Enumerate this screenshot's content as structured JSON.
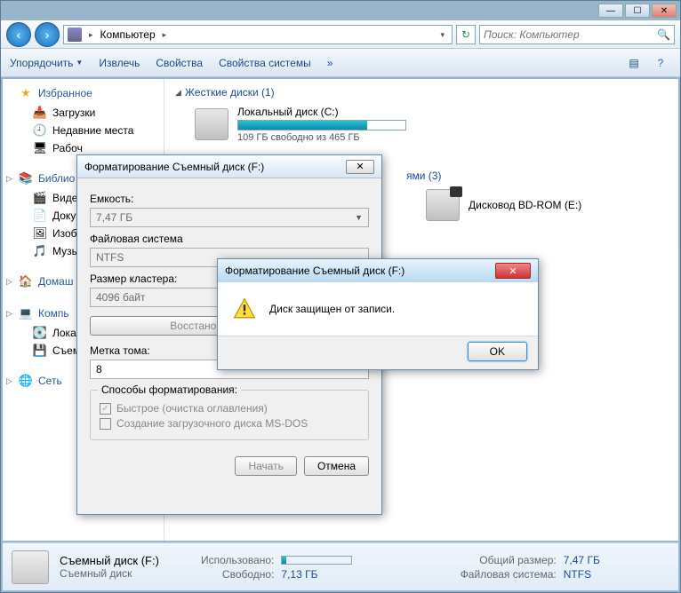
{
  "titlebar": {
    "min": "—",
    "max": "☐",
    "close": "✕"
  },
  "nav": {
    "back": "‹",
    "forward": "›",
    "breadcrumb": "Компьютер",
    "chevron": "▸",
    "refresh": "↻",
    "search_placeholder": "Поиск: Компьютер",
    "search_icon": "🔍"
  },
  "toolbar": {
    "organize": "Упорядочить",
    "extract": "Извлечь",
    "properties": "Свойства",
    "system_props": "Свойства системы",
    "more": "»",
    "view": "▤",
    "help": "?"
  },
  "sidebar": {
    "favorites": {
      "label": "Избранное",
      "star": "★",
      "items": [
        "Загрузки",
        "Недавние места",
        "Рабоч"
      ]
    },
    "libraries": {
      "label": "Библио",
      "items": [
        "Видео",
        "Докум",
        "Изобр",
        "Музы"
      ]
    },
    "homegroup": {
      "label": "Домаш"
    },
    "computer": {
      "label": "Компь",
      "items": [
        "Локал",
        "Съемн"
      ]
    },
    "network": {
      "label": "Сеть"
    }
  },
  "content": {
    "hdd_section": "Жесткие диски (1)",
    "drive_c": {
      "name": "Локальный диск (C:)",
      "free": "109 ГБ свободно из 465 ГБ",
      "fill_pct": 77
    },
    "removable_suffix": "ями (3)",
    "bd_drive": "Дисковод BD-ROM (E:)"
  },
  "details": {
    "title": "Съемный диск (F:)",
    "sub": "Съемный диск",
    "used_k": "Использовано:",
    "total_k": "Общий размер:",
    "total_v": "7,47 ГБ",
    "free_k": "Свободно:",
    "free_v": "7,13 ГБ",
    "fs_k": "Файловая система:",
    "fs_v": "NTFS"
  },
  "format_dialog": {
    "title": "Форматирование Съемный диск (F:)",
    "capacity_label": "Емкость:",
    "capacity_value": "7,47 ГБ",
    "fs_label": "Файловая система",
    "fs_value": "NTFS",
    "cluster_label": "Размер кластера:",
    "cluster_value": "4096 байт",
    "restore_btn": "Восстановить параметр",
    "volume_label": "Метка тома:",
    "volume_value": "8",
    "methods_label": "Способы форматирования:",
    "quick": "Быстрое (очистка оглавления)",
    "msdos": "Создание загрузочного диска MS-DOS",
    "start": "Начать",
    "cancel": "Отмена",
    "close": "✕"
  },
  "msgbox": {
    "title": "Форматирование Съемный диск (F:)",
    "text": "Диск защищен от записи.",
    "ok": "OK",
    "close": "✕"
  }
}
